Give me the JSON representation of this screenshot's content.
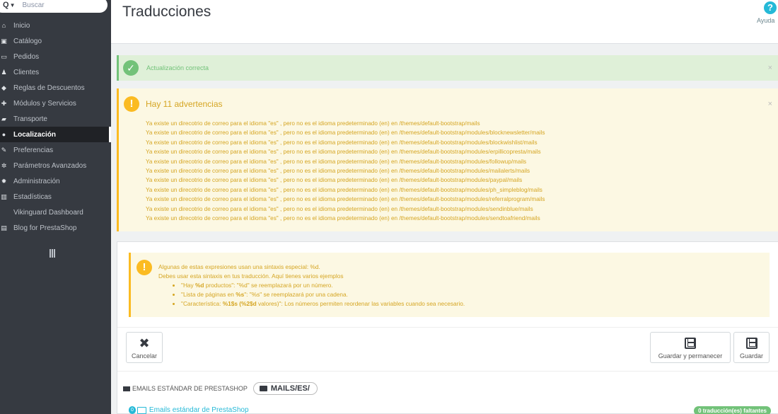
{
  "sidebar": {
    "search_placeholder": "Buscar",
    "items": [
      {
        "label": "Inicio",
        "icon": "dashboard-icon",
        "glyph": "⌂",
        "active": false
      },
      {
        "label": "Catálogo",
        "icon": "catalog-icon",
        "glyph": "▣",
        "active": false
      },
      {
        "label": "Pedidos",
        "icon": "orders-icon",
        "glyph": "▭",
        "active": false
      },
      {
        "label": "Clientes",
        "icon": "customers-icon",
        "glyph": "♟",
        "active": false
      },
      {
        "label": "Reglas de Descuentos",
        "icon": "tag-icon",
        "glyph": "◆",
        "active": false
      },
      {
        "label": "Módulos y Servicios",
        "icon": "puzzle-icon",
        "glyph": "✚",
        "active": false
      },
      {
        "label": "Transporte",
        "icon": "truck-icon",
        "glyph": "▰",
        "active": false
      },
      {
        "label": "Localización",
        "icon": "globe-icon",
        "glyph": "●",
        "active": true
      },
      {
        "label": "Preferencias",
        "icon": "wrench-icon",
        "glyph": "✎",
        "active": false
      },
      {
        "label": "Parámetros Avanzados",
        "icon": "cogs-icon",
        "glyph": "✲",
        "active": false
      },
      {
        "label": "Administración",
        "icon": "cog-icon",
        "glyph": "✹",
        "active": false
      },
      {
        "label": "Estadísticas",
        "icon": "bar-chart-icon",
        "glyph": "▥",
        "active": false
      },
      {
        "label": "Vikinguard Dashboard",
        "icon": "",
        "glyph": "",
        "active": false
      },
      {
        "label": "Blog for PrestaShop",
        "icon": "file-icon",
        "glyph": "▤",
        "active": false
      }
    ]
  },
  "header": {
    "title": "Traducciones",
    "help_label": "Ayuda"
  },
  "alerts": {
    "success_message": "Actualización correcta",
    "warning_title": "Hay 11 advertencias",
    "warnings": [
      "Ya existe un direcotrio de correo para el idioma \"es\" , pero no es el idioma predeterminado (en) en /themes/default-bootstrap/mails",
      "Ya existe un direcotrio de correo para el idioma \"es\" , pero no es el idioma predeterminado (en) en /themes/default-bootstrap/modules/blocknewsletter/mails",
      "Ya existe un direcotrio de correo para el idioma \"es\" , pero no es el idioma predeterminado (en) en /themes/default-bootstrap/modules/blockwishlist/mails",
      "Ya existe un direcotrio de correo para el idioma \"es\" , pero no es el idioma predeterminado (en) en /themes/default-bootstrap/modules/erpillicopresta/mails",
      "Ya existe un direcotrio de correo para el idioma \"es\" , pero no es el idioma predeterminado (en) en /themes/default-bootstrap/modules/followup/mails",
      "Ya existe un direcotrio de correo para el idioma \"es\" , pero no es el idioma predeterminado (en) en /themes/default-bootstrap/modules/mailalerts/mails",
      "Ya existe un direcotrio de correo para el idioma \"es\" , pero no es el idioma predeterminado (en) en /themes/default-bootstrap/modules/paypal/mails",
      "Ya existe un direcotrio de correo para el idioma \"es\" , pero no es el idioma predeterminado (en) en /themes/default-bootstrap/modules/ph_simpleblog/mails",
      "Ya existe un direcotrio de correo para el idioma \"es\" , pero no es el idioma predeterminado (en) en /themes/default-bootstrap/modules/referralprogram/mails",
      "Ya existe un direcotrio de correo para el idioma \"es\" , pero no es el idioma predeterminado (en) en /themes/default-bootstrap/modules/sendinblue/mails",
      "Ya existe un direcotrio de correo para el idioma \"es\" , pero no es el idioma predeterminado (en) en /themes/default-bootstrap/modules/sendtoafriend/mails"
    ]
  },
  "syntax_note": {
    "line1": "Algunas de estas expresiones usan una sintaxis especial: %d.",
    "line2": "Debes usar esta sintaxis en tus traducción. Aquí tienes varios ejemplos",
    "examples": [
      {
        "pre": "\"Hay ",
        "bold": "%d",
        "post": " productos\": \"%d\" se reemplazará por un número."
      },
      {
        "pre": "\"Lista de páginas en ",
        "bold": "%s",
        "post": "\": \"%s\" se reemplazará por una cadena."
      },
      {
        "pre": "\"Característica: ",
        "bold": "%1$s (%2$d",
        "post": " valores)\": Los números permiten reordenar las variables cuando sea necesario."
      }
    ]
  },
  "toolbar": {
    "cancel_label": "Cancelar",
    "save_stay_label": "Guardar y permanecer",
    "save_label": "Guardar"
  },
  "emails": {
    "section_label": "EMAILS ESTÁNDAR DE PRESTASHOP",
    "path": "MAILS/ES/",
    "count": "0",
    "link_label": "Emails estándar de PrestaShop",
    "missing_badge": "0 traducción(es) faltantes"
  },
  "colors": {
    "sidebar_bg": "#363a41",
    "success": "#72c279",
    "warning": "#fbbb22",
    "warning_text": "#d5a522",
    "accent": "#25b9d7"
  }
}
